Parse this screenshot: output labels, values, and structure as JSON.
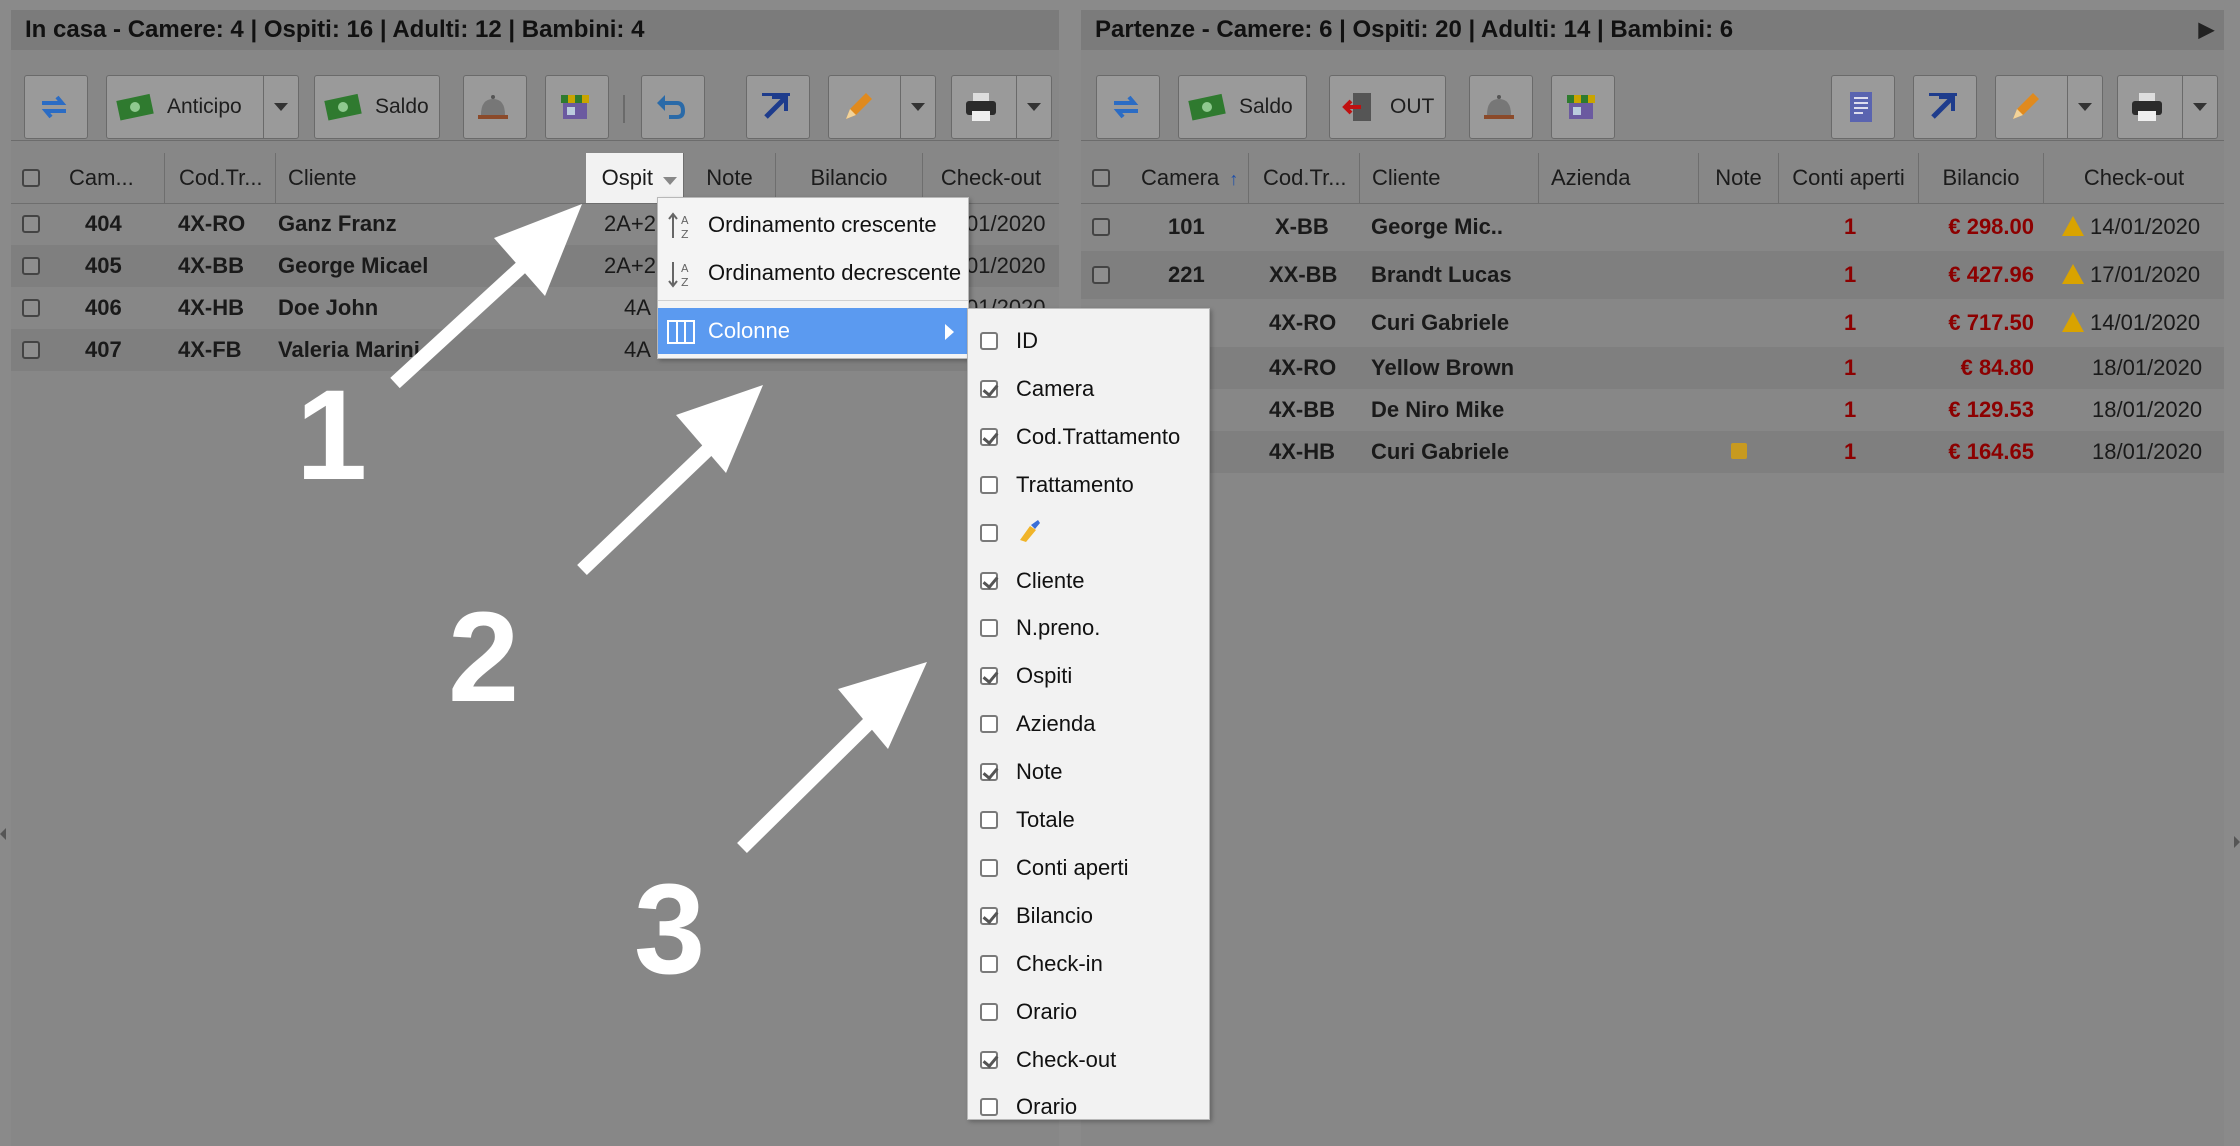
{
  "left": {
    "header": "In casa - Camere: 4 | Ospiti: 16 | Adulti: 12 | Bambini: 4",
    "toolbar": {
      "anticipo": "Anticipo",
      "saldo": "Saldo"
    },
    "columns": [
      "Cam...",
      "Cod.Tr...",
      "Cliente",
      "Ospit",
      "Note",
      "Bilancio",
      "Check-out"
    ],
    "rows": [
      {
        "camera": "404",
        "cod": "4X-RO",
        "cliente": "Ganz Franz",
        "ospiti": "2A+2",
        "checkout": "01/2020"
      },
      {
        "camera": "405",
        "cod": "4X-BB",
        "cliente": "George Micael",
        "ospiti": "2A+2",
        "checkout": "01/2020"
      },
      {
        "camera": "406",
        "cod": "4X-HB",
        "cliente": "Doe John",
        "ospiti": "4A",
        "checkout": "01/2020"
      },
      {
        "camera": "407",
        "cod": "4X-FB",
        "cliente": "Valeria Marini",
        "ospiti": "4A",
        "checkout": ""
      }
    ]
  },
  "right": {
    "header": "Partenze - Camere: 6 | Ospiti: 20 | Adulti: 14 | Bambini: 6",
    "toolbar": {
      "saldo": "Saldo",
      "out": "OUT"
    },
    "columns": [
      "Camera",
      "Cod.Tr...",
      "Cliente",
      "Azienda",
      "Note",
      "Conti aperti",
      "Bilancio",
      "Check-out"
    ],
    "rows": [
      {
        "camera": "101",
        "cod": "X-BB",
        "cliente": "George Mic..",
        "conti": "1",
        "bilancio": "€ 298.00",
        "checkout": "14/01/2020",
        "warn": true
      },
      {
        "camera": "221",
        "cod": "XX-BB",
        "cliente": "Brandt Lucas",
        "conti": "1",
        "bilancio": "€ 427.96",
        "checkout": "17/01/2020",
        "warn": true
      },
      {
        "camera": "",
        "cod": "4X-RO",
        "cliente": "Curi Gabriele",
        "conti": "1",
        "bilancio": "€ 717.50",
        "checkout": "14/01/2020",
        "warn": true
      },
      {
        "camera": "",
        "cod": "4X-RO",
        "cliente": "Yellow Brown",
        "conti": "1",
        "bilancio": "€ 84.80",
        "checkout": "18/01/2020",
        "warn": false
      },
      {
        "camera": "",
        "cod": "4X-BB",
        "cliente": "De Niro Mike",
        "conti": "1",
        "bilancio": "€ 129.53",
        "checkout": "18/01/2020",
        "warn": false
      },
      {
        "camera": "",
        "cod": "4X-HB",
        "cliente": "Curi Gabriele",
        "conti": "1",
        "bilancio": "€ 164.65",
        "checkout": "18/01/2020",
        "warn": false,
        "note": true
      }
    ]
  },
  "menu": {
    "sort_asc": "Ordinamento crescente",
    "sort_desc": "Ordinamento decrescente",
    "columns": "Colonne"
  },
  "columns_menu": [
    {
      "label": "ID",
      "checked": false
    },
    {
      "label": "Camera",
      "checked": true
    },
    {
      "label": "Cod.Trattamento",
      "checked": true
    },
    {
      "label": "Trattamento",
      "checked": false
    },
    {
      "label": "",
      "checked": false,
      "icon": "broom-icon"
    },
    {
      "label": "Cliente",
      "checked": true
    },
    {
      "label": "N.preno.",
      "checked": false
    },
    {
      "label": "Ospiti",
      "checked": true
    },
    {
      "label": "Azienda",
      "checked": false
    },
    {
      "label": "Note",
      "checked": true
    },
    {
      "label": "Totale",
      "checked": false
    },
    {
      "label": "Conti aperti",
      "checked": false
    },
    {
      "label": "Bilancio",
      "checked": true
    },
    {
      "label": "Check-in",
      "checked": false
    },
    {
      "label": "Orario",
      "checked": false
    },
    {
      "label": "Check-out",
      "checked": true
    },
    {
      "label": "Orario",
      "checked": false
    }
  ],
  "annotations": [
    "1",
    "2",
    "3"
  ],
  "colors": {
    "accent": "#5b9af0",
    "overlay": "#878787",
    "money": "#8c0000",
    "warning": "#d9a300"
  }
}
